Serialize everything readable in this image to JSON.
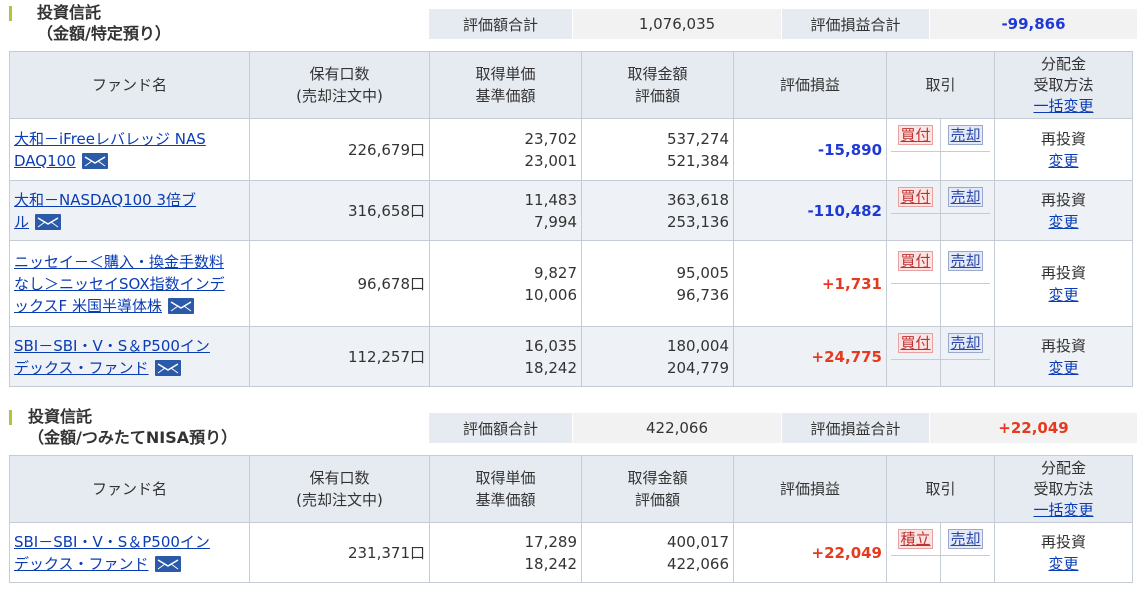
{
  "sections": [
    {
      "title": "投資信託",
      "subtitle": "（金額/特定預り）",
      "summary": {
        "total_label": "評価額合計",
        "total_value": "1,076,035",
        "pl_label": "評価損益合計",
        "pl_value": "-99,866"
      },
      "headers": {
        "fund": "ファンド名",
        "units_1": "保有口数",
        "units_2": "(売却注文中)",
        "unit_price_1": "取得単価",
        "unit_price_2": "基準価額",
        "amount_1": "取得金額",
        "amount_2": "評価額",
        "pl": "評価損益",
        "trade": "取引",
        "dist_1": "分配金",
        "dist_2": "受取方法",
        "dist_3": "一括変更"
      },
      "rows": [
        {
          "fund_1": "大和－iFreeレバレッジ NAS",
          "fund_2": "DAQ100",
          "units": "226,679口",
          "cost_price": "23,702",
          "nav": "23,001",
          "cost_amount": "537,274",
          "value": "521,384",
          "pl": "-15,890",
          "buy": "買付",
          "sell": "売却",
          "dist": "再投資",
          "dist_change": "変更"
        },
        {
          "fund_1": "大和－NASDAQ100 3倍ブ",
          "fund_2": "ル",
          "units": "316,658口",
          "cost_price": "11,483",
          "nav": "7,994",
          "cost_amount": "363,618",
          "value": "253,136",
          "pl": "-110,482",
          "buy": "買付",
          "sell": "売却",
          "dist": "再投資",
          "dist_change": "変更"
        },
        {
          "fund_1": "ニッセイ－＜購入・換金手数料",
          "fund_2": "なし＞ニッセイSOX指数インデ",
          "fund_3": "ックスF 米国半導体株",
          "units": "96,678口",
          "cost_price": "9,827",
          "nav": "10,006",
          "cost_amount": "95,005",
          "value": "96,736",
          "pl": "+1,731",
          "buy": "買付",
          "sell": "売却",
          "dist": "再投資",
          "dist_change": "変更"
        },
        {
          "fund_1": "SBI－SBI・V・S＆P500イン",
          "fund_2": "デックス・ファンド",
          "units": "112,257口",
          "cost_price": "16,035",
          "nav": "18,242",
          "cost_amount": "180,004",
          "value": "204,779",
          "pl": "+24,775",
          "buy": "買付",
          "sell": "売却",
          "dist": "再投資",
          "dist_change": "変更"
        }
      ]
    },
    {
      "title": "投資信託",
      "subtitle": "（金額/つみたてNISA預り）",
      "summary": {
        "total_label": "評価額合計",
        "total_value": "422,066",
        "pl_label": "評価損益合計",
        "pl_value": "+22,049"
      },
      "headers": {
        "fund": "ファンド名",
        "units_1": "保有口数",
        "units_2": "(売却注文中)",
        "unit_price_1": "取得単価",
        "unit_price_2": "基準価額",
        "amount_1": "取得金額",
        "amount_2": "評価額",
        "pl": "評価損益",
        "trade": "取引",
        "dist_1": "分配金",
        "dist_2": "受取方法",
        "dist_3": "一括変更"
      },
      "rows": [
        {
          "fund_1": "SBI－SBI・V・S＆P500イン",
          "fund_2": "デックス・ファンド",
          "units": "231,371口",
          "cost_price": "17,289",
          "nav": "18,242",
          "cost_amount": "400,017",
          "value": "422,066",
          "pl": "+22,049",
          "buy": "積立",
          "sell": "売却",
          "dist": "再投資",
          "dist_change": "変更"
        }
      ]
    }
  ],
  "colors": {
    "negative": "#1f3ad4",
    "positive": "#e63a1f",
    "link": "#0a3cb4",
    "header_bg": "#e6ebf1"
  },
  "icons": {
    "mail": "mail-icon"
  }
}
